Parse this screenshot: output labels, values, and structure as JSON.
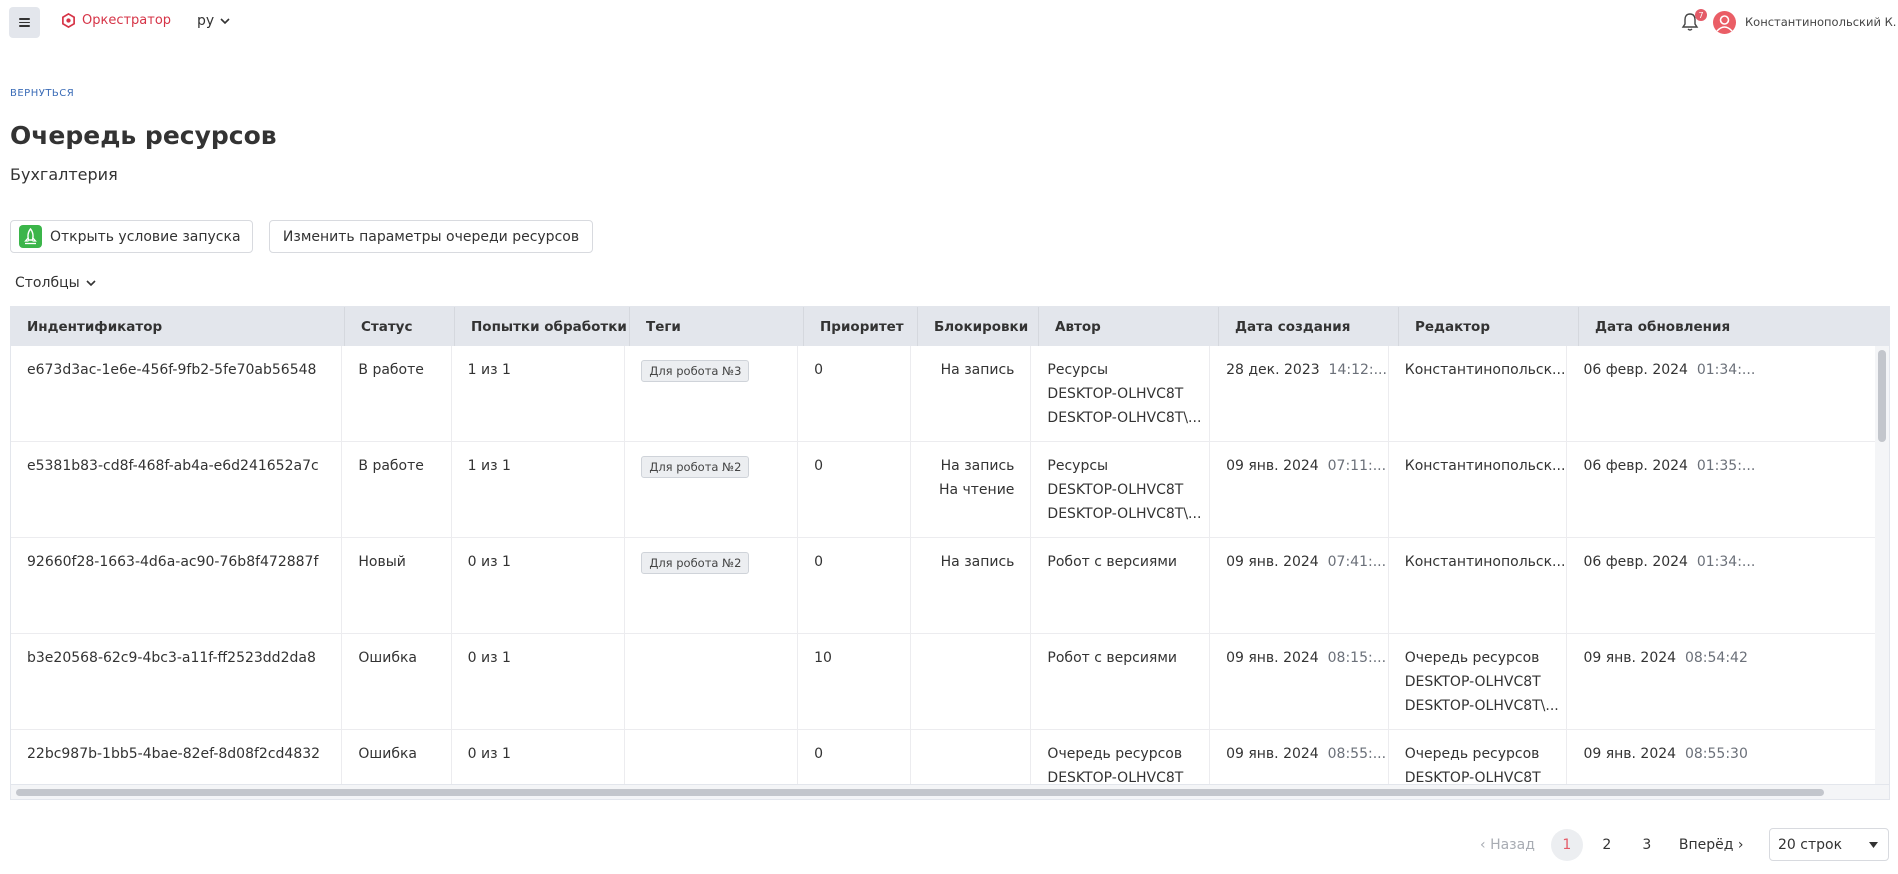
{
  "header": {
    "brand": "Оркестратор",
    "lang": "ру",
    "notifications_count": "7",
    "user_name": "Константинопольский К."
  },
  "back_label": "ВЕРНУТЬСЯ",
  "title": "Очередь ресурсов",
  "subtitle": "Бухгалтерия",
  "actions": {
    "open_label": "Открыть условие запуска",
    "edit_label": "Изменить параметры очереди ресурсов"
  },
  "columns_label": "Столбцы",
  "table": {
    "headers": [
      "Индентификатор",
      "Статус",
      "Попытки обработки",
      "Теги",
      "Приоритет",
      "Блокировки",
      "Автор",
      "Дата создания",
      "Редактор",
      "Дата обновления"
    ],
    "rows": [
      {
        "id": "e673d3ac-1e6e-456f-9fb2-5fe70ab56548",
        "status": "В работе",
        "attempts": "1 из 1",
        "tag": "Для робота №3",
        "priority": "0",
        "locks": [
          "На запись"
        ],
        "author": [
          "Ресурсы",
          "DESKTOP-OLHVC8T",
          "DESKTOP-OLHVC8T\\..."
        ],
        "created_date": "28 дек. 2023",
        "created_time": "14:12:...",
        "editor": [
          "Константинопольск..."
        ],
        "updated_date": "06 февр. 2024",
        "updated_time": "01:34:..."
      },
      {
        "id": "e5381b83-cd8f-468f-ab4a-e6d241652a7c",
        "status": "В работе",
        "attempts": "1 из 1",
        "tag": "Для робота №2",
        "priority": "0",
        "locks": [
          "На запись",
          "На чтение"
        ],
        "author": [
          "Ресурсы",
          "DESKTOP-OLHVC8T",
          "DESKTOP-OLHVC8T\\..."
        ],
        "created_date": "09 янв. 2024",
        "created_time": "07:11:...",
        "editor": [
          "Константинопольск..."
        ],
        "updated_date": "06 февр. 2024",
        "updated_time": "01:35:..."
      },
      {
        "id": "92660f28-1663-4d6a-ac90-76b8f472887f",
        "status": "Новый",
        "attempts": "0 из 1",
        "tag": "Для робота №2",
        "priority": "0",
        "locks": [
          "На запись"
        ],
        "author": [
          "Робот с версиями"
        ],
        "created_date": "09 янв. 2024",
        "created_time": "07:41:...",
        "editor": [
          "Константинопольск..."
        ],
        "updated_date": "06 февр. 2024",
        "updated_time": "01:34:..."
      },
      {
        "id": "b3e20568-62c9-4bc3-a11f-ff2523dd2da8",
        "status": "Ошибка",
        "attempts": "0 из 1",
        "tag": "",
        "priority": "10",
        "locks": [],
        "author": [
          "Робот с версиями"
        ],
        "created_date": "09 янв. 2024",
        "created_time": "08:15:...",
        "editor": [
          "Очередь ресурсов",
          "DESKTOP-OLHVC8T",
          "DESKTOP-OLHVC8T\\..."
        ],
        "updated_date": "09 янв. 2024",
        "updated_time": "08:54:42"
      },
      {
        "id": "22bc987b-1bb5-4bae-82ef-8d08f2cd4832",
        "status": "Ошибка",
        "attempts": "0 из 1",
        "tag": "",
        "priority": "0",
        "locks": [],
        "author": [
          "Очередь ресурсов",
          "DESKTOP-OLHVC8T"
        ],
        "created_date": "09 янв. 2024",
        "created_time": "08:55:...",
        "editor": [
          "Очередь ресурсов",
          "DESKTOP-OLHVC8T"
        ],
        "updated_date": "09 янв. 2024",
        "updated_time": "08:55:30"
      }
    ]
  },
  "pagination": {
    "prev_label": "Назад",
    "pages": [
      "1",
      "2",
      "3"
    ],
    "active_page": "1",
    "next_label": "Вперёд",
    "rows_per_page": "20 строк"
  },
  "icons": {
    "menu": "hamburger-icon",
    "brand": "hexagon-logo-icon",
    "bell": "bell-icon",
    "avatar": "user-avatar-icon",
    "launch": "rocket-icon"
  },
  "colors": {
    "brand": "#d63447",
    "accent_link": "#3b6cb7",
    "header_bg": "#e3e6ec",
    "launch_icon_bg": "#3bb54a",
    "active_page": "#e45b68"
  }
}
